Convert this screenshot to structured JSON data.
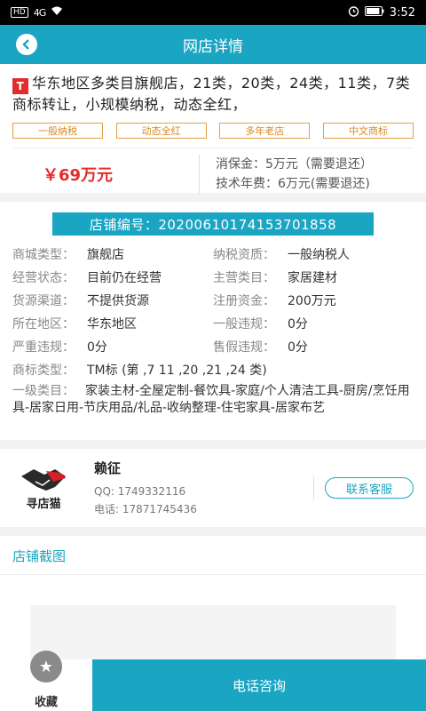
{
  "status": {
    "time": "3:52",
    "hd": "HD",
    "signal": "4G",
    "battery_level": 0.85
  },
  "header": {
    "title": "网店详情"
  },
  "listing": {
    "badge": "T",
    "title": "华东地区多类目旗舰店，21类，20类，24类，11类，7类商标转让，小规模纳税，动态全红，",
    "tags": [
      "一般纳税",
      "动态全红",
      "多年老店",
      "中文商标"
    ],
    "price": "￥69万元",
    "deposit": "消保金：5万元（需要退还）",
    "tech_fee": "技术年费：6万元(需要退还)"
  },
  "store": {
    "number": "店铺编号：20200610174153701858",
    "fields": [
      {
        "key": "商城类型：",
        "value": "旗舰店"
      },
      {
        "key": "纳税资质：",
        "value": "一般纳税人"
      },
      {
        "key": "经营状态：",
        "value": "目前仍在经营"
      },
      {
        "key": "主营类目：",
        "value": "家居建材"
      },
      {
        "key": "货源渠道：",
        "value": "不提供货源"
      },
      {
        "key": "注册资金：",
        "value": "200万元"
      },
      {
        "key": "所在地区：",
        "value": "华东地区"
      },
      {
        "key": "一般违规：",
        "value": "0分"
      },
      {
        "key": "严重违规：",
        "value": "0分"
      },
      {
        "key": "售假违规：",
        "value": "0分"
      }
    ],
    "trademark_key": "商标类型：",
    "trademark_value": "TM标 (第 ,7 11 ,20 ,21 ,24 类)",
    "category_key": "一级类目：",
    "category_value": "家装主材-全屋定制-餐饮具-家庭/个人清洁工具-厨房/烹饪用具-居家日用-节庆用品/礼品-收纳整理-住宅家具-居家布艺"
  },
  "contact": {
    "logo_text": "寻店猫",
    "name": "赖征",
    "qq": "QQ: 1749332116",
    "phone": "电话: 17871745436",
    "service_button": "联系客服"
  },
  "screenshots": {
    "title": "店铺截图"
  },
  "bottom": {
    "favorite": "收藏",
    "call": "电话咨询"
  },
  "colors": {
    "accent": "#1aa5c3",
    "price": "#e42c2c",
    "tag": "#d98a1f"
  }
}
